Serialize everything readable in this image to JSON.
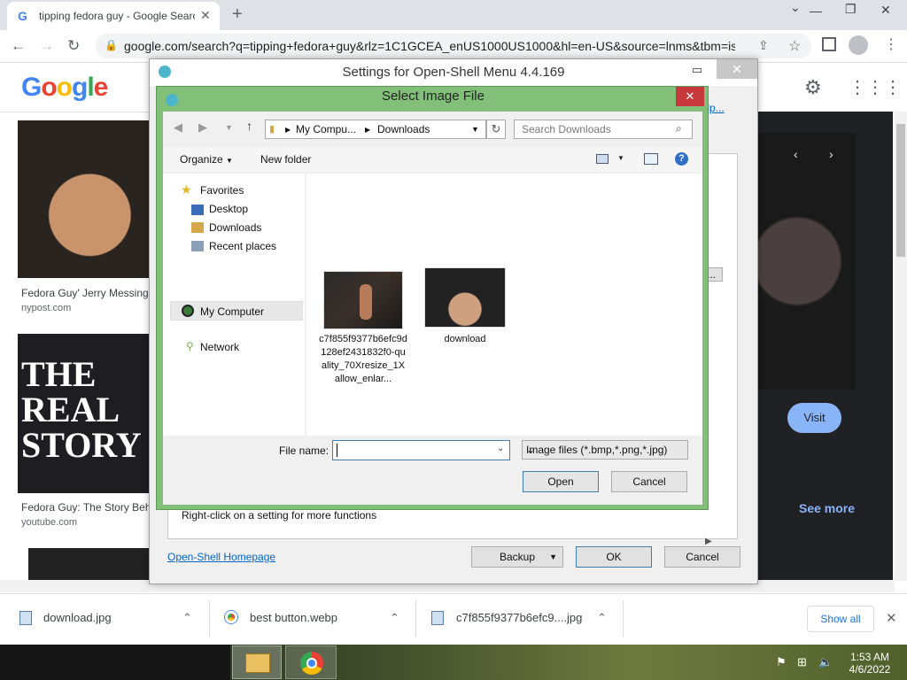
{
  "browser": {
    "tab_title": "tipping fedora guy - Google Search",
    "tab_favicon": "G",
    "new_tab": "+",
    "url": "google.com/search?q=tipping+fedora+guy&rlz=1C1GCEA_enUS1000US1000&hl=en-US&source=lnms&tbm=isch",
    "window_controls": {
      "minimize": "—",
      "restore": "❐",
      "close": "✕",
      "chevron": "⌄"
    }
  },
  "google": {
    "logo_letters": [
      {
        "ch": "G",
        "color": "#4285f4"
      },
      {
        "ch": "o",
        "color": "#ea4335"
      },
      {
        "ch": "o",
        "color": "#fbbc05"
      },
      {
        "ch": "g",
        "color": "#4285f4"
      },
      {
        "ch": "l",
        "color": "#34a853"
      },
      {
        "ch": "e",
        "color": "#ea4335"
      }
    ],
    "results": [
      {
        "caption": "Fedora Guy' Jerry Messing",
        "source": "nypost.com"
      },
      {
        "caption": "Fedora Guy: The Story Beh",
        "source": "youtube.com"
      }
    ],
    "thumb2_text": "THE\nREAL\nSTORY",
    "visit_label": "Visit",
    "see_more_label": "See more"
  },
  "settings": {
    "title": "Settings for Open-Shell Menu 4.4.169",
    "help_link": "Help...",
    "hint": "Right-click on a setting for more functions",
    "homepage_link": "Open-Shell Homepage",
    "backup_label": "Backup",
    "ok_label": "OK",
    "cancel_label": "Cancel",
    "ellipsis_btn": "..."
  },
  "dialog": {
    "title": "Select Image File",
    "close": "✕",
    "address_parts": [
      "My Compu...",
      "Downloads"
    ],
    "search_placeholder": "Search Downloads",
    "organize_label": "Organize",
    "new_folder_label": "New folder",
    "nav": {
      "favorites": "Favorites",
      "desktop": "Desktop",
      "downloads": "Downloads",
      "recent": "Recent places",
      "my_computer": "My Computer",
      "network": "Network"
    },
    "files": [
      {
        "name": "c7f855f9377b6efc9d128ef2431832f0-quality_70Xresize_1Xallow_enlar..."
      },
      {
        "name": "download"
      }
    ],
    "file_name_label": "File name:",
    "file_name_value": "",
    "file_type": "Image files (*.bmp,*.png,*.jpg)",
    "open_label": "Open",
    "cancel_label": "Cancel"
  },
  "downloads": {
    "items": [
      "download.jpg",
      "best button.webp",
      "c7f855f9377b6efc9....jpg"
    ],
    "show_all": "Show all"
  },
  "taskbar": {
    "time": "1:53 AM",
    "date": "4/6/2022"
  }
}
